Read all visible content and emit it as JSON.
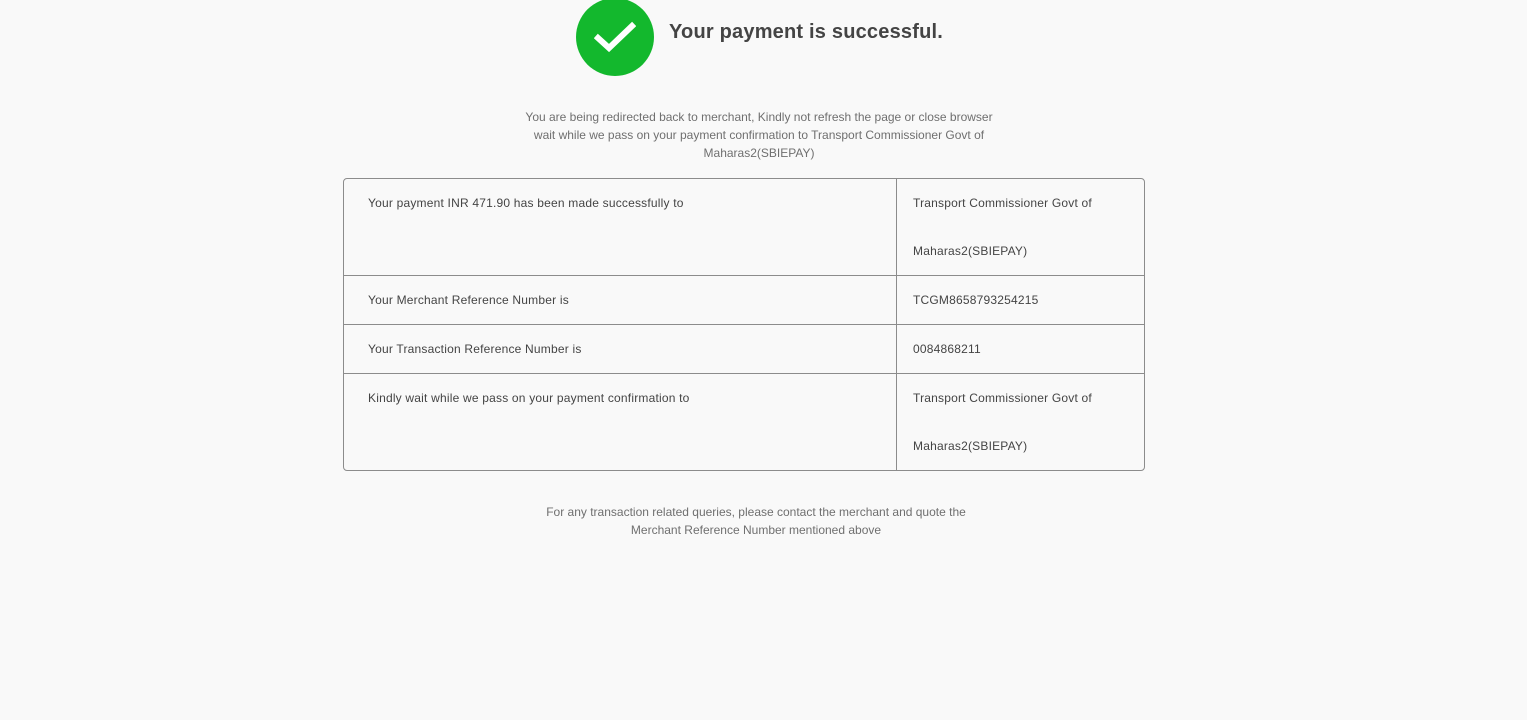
{
  "header": {
    "title": "Your payment is successful.",
    "icon": "check-circle-icon",
    "icon_color": "#13b82d"
  },
  "redirect_message": {
    "line1": "You are being redirected back to merchant, Kindly not refresh the page or close browser",
    "line2": "wait while we pass on your payment confirmation to Transport Commissioner Govt of",
    "line3": "Maharas2(SBIEPAY)"
  },
  "table": {
    "rows": [
      {
        "label": "Your payment INR 471.90 has been made successfully to",
        "value_line1": "Transport Commissioner Govt of",
        "value_line2": "Maharas2(SBIEPAY)"
      },
      {
        "label": "Your Merchant Reference Number is",
        "value": "TCGM8658793254215"
      },
      {
        "label": "Your Transaction Reference Number is",
        "value": "0084868211"
      },
      {
        "label": "Kindly wait while we pass on your payment confirmation to",
        "value_line1": "Transport Commissioner Govt of",
        "value_line2": "Maharas2(SBIEPAY)"
      }
    ]
  },
  "footer": {
    "line1": "For any transaction related queries, please contact the merchant and quote the",
    "line2": "Merchant Reference Number mentioned above"
  }
}
